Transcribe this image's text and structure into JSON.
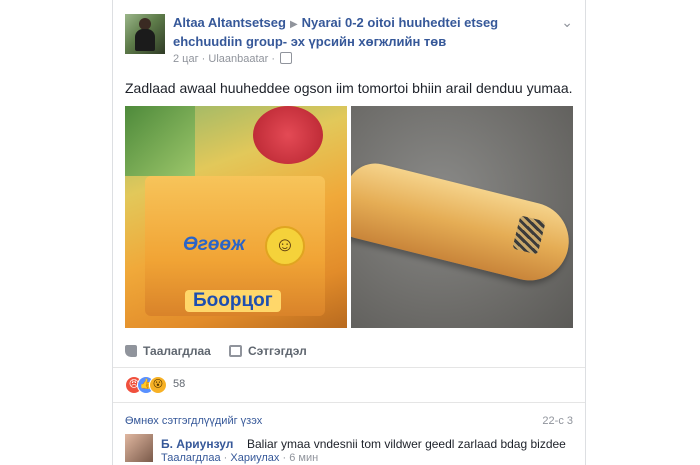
{
  "post": {
    "author": "Altaa Altantsetseg",
    "arrow": "▶",
    "group_name": "Nyarai 0-2 oitoi huuhedtei etseg ehchuudiin group- эх үрсийн хөгжлийн төв",
    "time": "2 цаг",
    "location": "Ulaanbaatar",
    "separator": "·",
    "text": "Zadlaad awaal huuheddee ogson iim tomortoi bhiin arail denduu yumaa.",
    "photo1_brand_top": "Өгөөж",
    "photo1_brand_bottom": "Боорцог",
    "chevron": "⌄"
  },
  "actions": {
    "like_label": "Таалагдлаа",
    "comment_label": "Сэтгэгдэл"
  },
  "reactions": {
    "count": "58",
    "angry": "😠",
    "like": "👍",
    "wow": "😮"
  },
  "comments": {
    "previous_label": "Өмнөх сэтгэгдлүүдийг үзэх",
    "count_label": "22-с 3",
    "items": [
      {
        "author": "Б. Ариунзул",
        "text": "Baliar ymaa vndesnii tom vildwer geedl zarlaad bdag bizdee",
        "like_label": "Таалагдлаа",
        "reply_label": "Хариулах",
        "time": "6 мин",
        "sep": "·"
      }
    ]
  },
  "colors": {
    "link": "#365899",
    "meta": "#90949c",
    "text": "#1d2129"
  }
}
